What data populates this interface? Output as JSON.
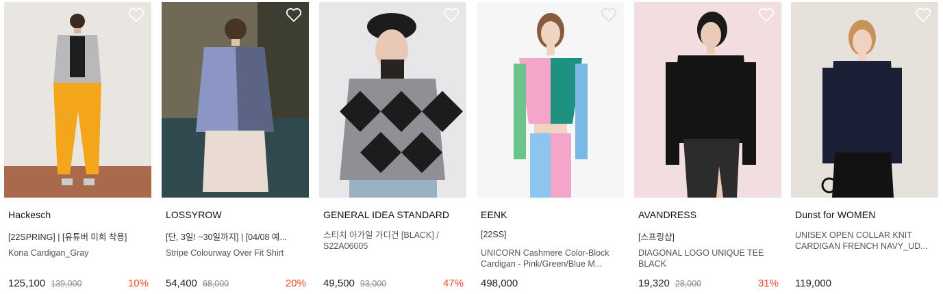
{
  "products": [
    {
      "brand": "Hackesch",
      "tag": "[22SPRING] | [유튜버 미희 착용]",
      "name_line1": "Kona Cardigan_Gray",
      "name_line2": "",
      "price": "125,100",
      "original_price": "139,000",
      "discount": "10%",
      "image": "model-gray-cardigan-orange-pants"
    },
    {
      "brand": "LOSSYROW",
      "tag": "[단, 3일! ~30일까지] | [04/08 예...",
      "name_line1": "Stripe Colourway Over Fit Shirt",
      "name_line2": "",
      "price": "54,400",
      "original_price": "68,000",
      "discount": "20%",
      "image": "model-striped-shirt-cafe"
    },
    {
      "brand": "GENERAL IDEA STANDARD",
      "tag": "",
      "name_line1": "스티치 아가일 가디건 [BLACK] /",
      "name_line2": "S22A06005",
      "price": "49,500",
      "original_price": "93,000",
      "discount": "47%",
      "image": "model-argyle-cardigan-beret"
    },
    {
      "brand": "EENK",
      "tag": "[22SS]",
      "name_line1": "UNICORN Cashmere Color-Block",
      "name_line2": "Cardigan - Pink/Green/Blue M...",
      "price": "498,000",
      "original_price": "",
      "discount": "",
      "image": "model-color-block-cardigan"
    },
    {
      "brand": "AVANDRESS",
      "tag": "[스프링샵]",
      "name_line1": "DIAGONAL LOGO UNIQUE TEE",
      "name_line2": "BLACK",
      "price": "19,320",
      "original_price": "28,000",
      "discount": "31%",
      "image": "model-black-tee-leather-skirt"
    },
    {
      "brand": "Dunst for WOMEN",
      "tag": "",
      "name_line1": "UNISEX OPEN COLLAR KNIT",
      "name_line2": "CARDIGAN FRENCH NAVY_UD...",
      "price": "119,000",
      "original_price": "",
      "discount": "",
      "image": "model-navy-knit-cardigan"
    }
  ],
  "colors": {
    "discount": "#f0492e",
    "text": "#222222",
    "muted": "#888888"
  },
  "icons": {
    "wishlist": "heart-outline-icon"
  }
}
